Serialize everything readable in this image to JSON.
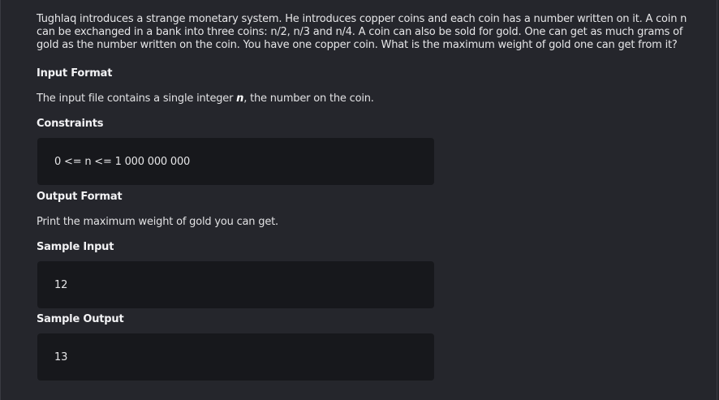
{
  "problem": {
    "statement": "Tughlaq introduces a strange monetary system. He introduces copper coins and each coin has a number written on it. A coin n can be exchanged in a bank into three coins: n/2, n/3 and n/4. A coin can also be sold for gold. One can get as much grams of gold as the number written on the coin. You have one copper coin. What is the maximum weight of gold one can get from it?",
    "input_format_heading": "Input Format",
    "input_format_before": "The input file contains a single integer ",
    "input_format_var": "n",
    "input_format_after": ", the number on the coin.",
    "constraints_heading": "Constraints",
    "constraints_value": "0 <= n <= 1 000 000 000",
    "output_format_heading": "Output Format",
    "output_format_text": "Print the maximum weight of gold you can get.",
    "sample_input_heading": "Sample Input",
    "sample_input_value": "12",
    "sample_output_heading": "Sample Output",
    "sample_output_value": "13"
  }
}
